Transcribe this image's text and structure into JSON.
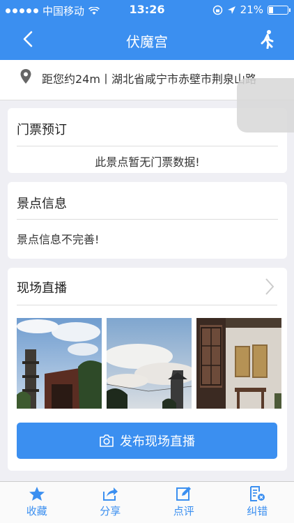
{
  "status_bar": {
    "carrier": "中国移动",
    "time": "13:26",
    "battery": "21%"
  },
  "nav": {
    "title": "伏魔宫"
  },
  "location": {
    "text": "距您约24m丨湖北省咸宁市赤壁市荆泉山路"
  },
  "tickets": {
    "title": "门票预订",
    "message": "此景点暂无门票数据!"
  },
  "info": {
    "title": "景点信息",
    "message": "景点信息不完善!"
  },
  "live": {
    "title": "现场直播",
    "publish_label": "发布现场直播"
  },
  "tabs": [
    {
      "label": "收藏",
      "icon": "star-icon"
    },
    {
      "label": "分享",
      "icon": "share-icon"
    },
    {
      "label": "点评",
      "icon": "edit-icon"
    },
    {
      "label": "纠错",
      "icon": "report-error-icon"
    }
  ],
  "colors": {
    "accent": "#3b8ff0",
    "background": "#efeff4"
  }
}
